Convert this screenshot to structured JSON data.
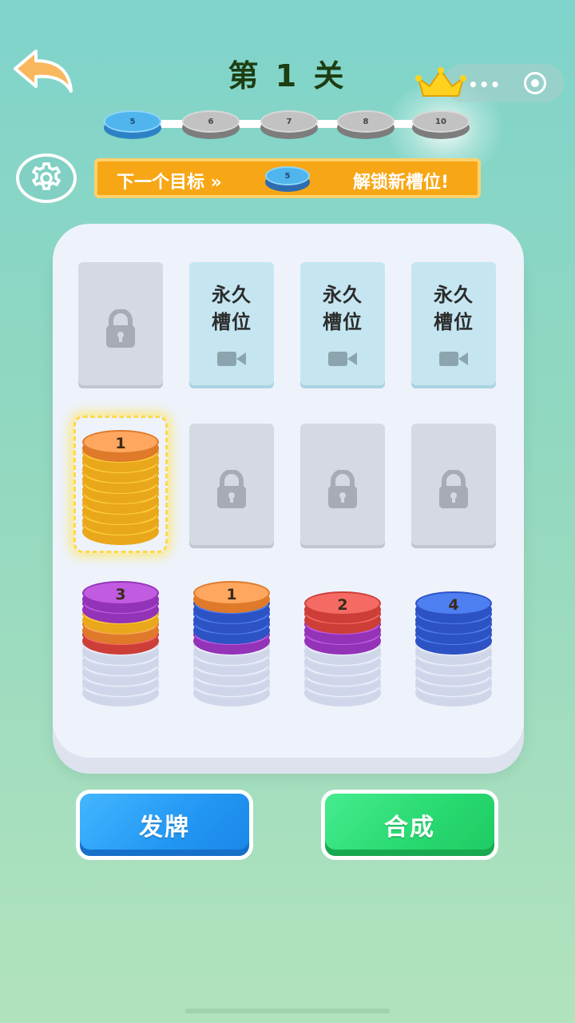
{
  "header": {
    "level_title": "第 1 关",
    "back_icon": "back-arrow-icon",
    "crown_icon": "crown-icon",
    "capsule_more": "•••"
  },
  "progress": {
    "steps": [
      {
        "label": "5",
        "state": "current"
      },
      {
        "label": "6",
        "state": "locked"
      },
      {
        "label": "7",
        "state": "locked"
      },
      {
        "label": "8",
        "state": "locked"
      },
      {
        "label": "10",
        "state": "locked"
      }
    ]
  },
  "banner": {
    "left_text": "下一个目标 »",
    "chip_label": "5",
    "right_text": "解锁新槽位!"
  },
  "board": {
    "perm_slot_text_line1": "永久",
    "perm_slot_text_line2": "槽位",
    "stacks": [
      {
        "top_number": "1",
        "colors": [
          "yellow",
          "yellow",
          "yellow",
          "yellow",
          "yellow",
          "yellow",
          "yellow",
          "yellow",
          "orange"
        ]
      },
      {
        "top_number": "3",
        "colors": [
          "empty",
          "empty",
          "empty",
          "empty",
          "empty",
          "red",
          "orange",
          "yellow",
          "purple",
          "purple"
        ]
      },
      {
        "top_number": "1",
        "colors": [
          "empty",
          "empty",
          "empty",
          "empty",
          "empty",
          "purple",
          "blue",
          "blue",
          "blue",
          "orange"
        ]
      },
      {
        "top_number": "2",
        "colors": [
          "empty",
          "empty",
          "empty",
          "empty",
          "empty",
          "purple",
          "purple",
          "red",
          "red"
        ]
      },
      {
        "top_number": "4",
        "colors": [
          "empty",
          "empty",
          "empty",
          "empty",
          "empty",
          "blue",
          "blue",
          "blue",
          "blue"
        ]
      }
    ]
  },
  "buttons": {
    "deal_label": "发牌",
    "merge_label": "合成"
  },
  "colors": {
    "yellow": [
      "#ffce3a",
      "#e9a81b"
    ],
    "orange": [
      "#ffa75e",
      "#de7a2a"
    ],
    "red": [
      "#f56b63",
      "#cc3e37"
    ],
    "purple": [
      "#c15ce0",
      "#9333b8"
    ],
    "blue": [
      "#4e7ff0",
      "#2d52c4"
    ]
  }
}
